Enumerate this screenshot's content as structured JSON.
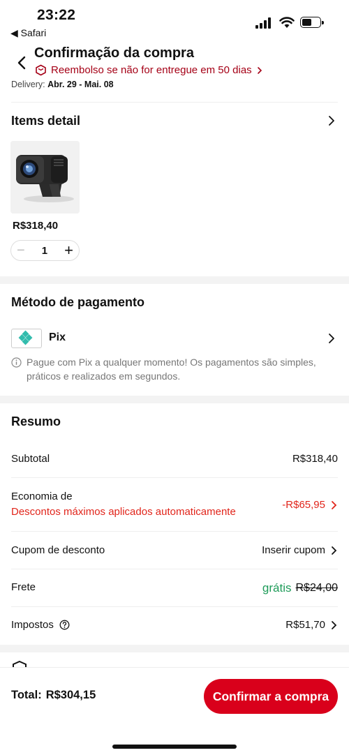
{
  "status_bar": {
    "time": "23:22",
    "back_app": "◀ Safari"
  },
  "header": {
    "title": "Confirmação da compra",
    "refund_text": "Reembolso se não for entregue em 50 dias",
    "delivery_label": "Delivery:",
    "delivery_dates": "Abr. 29 - Mai. 08"
  },
  "items": {
    "title": "Items detail",
    "product_price": "R$318,40",
    "quantity": "1",
    "minus": "−",
    "plus": "+"
  },
  "payment": {
    "title": "Método de pagamento",
    "method": "Pix",
    "note": "Pague com Pix a qualquer momento! Os pagamentos são simples, práticos e realizados em segundos."
  },
  "summary": {
    "title": "Resumo",
    "subtotal_label": "Subtotal",
    "subtotal_value": "R$318,40",
    "savings_label": "Economia de",
    "savings_sub": "Descontos máximos aplicados automaticamente",
    "savings_value": "-R$65,95",
    "coupon_label": "Cupom de desconto",
    "coupon_value": "Inserir cupom",
    "shipping_label": "Frete",
    "shipping_free": "grátis",
    "shipping_old": "R$24,00",
    "taxes_label": "Impostos",
    "taxes_value": "R$51,70"
  },
  "footer": {
    "total_label": "Total:",
    "total_value": "R$304,15",
    "confirm_label": "Confirmar a compra"
  },
  "colors": {
    "accent": "#d9001b",
    "discount": "#e1251b",
    "free": "#1f9c5a",
    "refund": "#a50016"
  }
}
